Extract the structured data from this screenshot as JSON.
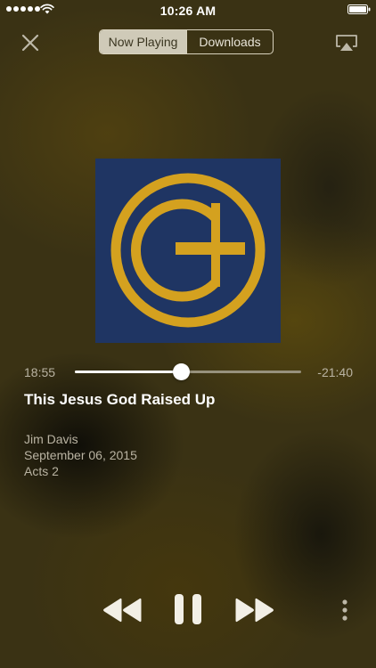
{
  "status_bar": {
    "time": "10:26 AM",
    "signal_bars": 5,
    "icons": [
      "signal-dots-icon",
      "wifi-icon",
      "battery-icon"
    ]
  },
  "nav": {
    "close_icon": "close-icon",
    "tabs": [
      {
        "label": "Now Playing",
        "selected": true
      },
      {
        "label": "Downloads",
        "selected": false
      }
    ],
    "airplay_icon": "airplay-icon"
  },
  "artwork": {
    "icon": "church-logo-icon",
    "background_color": "#1f3563",
    "logo_color": "#d4a11f"
  },
  "player": {
    "elapsed": "18:55",
    "remaining": "-21:40",
    "progress": 0.47
  },
  "episode": {
    "title": "This Jesus God Raised Up",
    "speaker": "Jim Davis",
    "date": "September 06, 2015",
    "passage": "Acts 2"
  },
  "controls": {
    "rewind_icon": "rewind-icon",
    "pause_icon": "pause-icon",
    "fast_forward_icon": "fast-forward-icon",
    "more_icon": "more-vertical-icon"
  }
}
